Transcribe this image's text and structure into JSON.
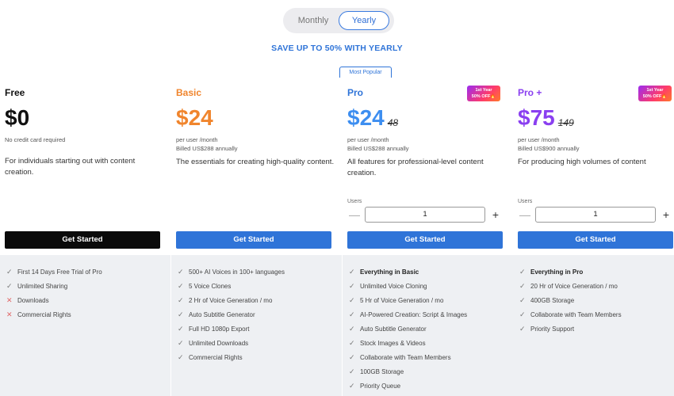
{
  "billing_toggle": {
    "monthly": "Monthly",
    "yearly": "Yearly"
  },
  "save_banner": "SAVE UP TO 50% WITH YEARLY",
  "most_popular": "Most Popular",
  "badge": {
    "line1": "1st Year",
    "line2": "50% OFF"
  },
  "users_label": "Users",
  "colors": {
    "blue": "#2f74d8",
    "orange": "#f0852d",
    "purple": "#8a3ff0",
    "black": "#0a0a0a"
  },
  "plans": [
    {
      "name": "Free",
      "price": "$0",
      "sub1": "No credit card required",
      "sub2": "",
      "desc": "For individuals starting out with content creation.",
      "button": "Get Started",
      "features": [
        {
          "icon": "check-icon",
          "text": "First 14 Days Free Trial of Pro"
        },
        {
          "icon": "check-icon",
          "text": "Unlimited Sharing"
        },
        {
          "icon": "x-icon",
          "text": "Downloads"
        },
        {
          "icon": "x-icon",
          "text": "Commercial Rights"
        }
      ]
    },
    {
      "name": "Basic",
      "price": "$24",
      "sub1": "per user /month",
      "sub2": "Billed US$288 annually",
      "desc": "The essentials for creating high-quality content.",
      "button": "Get Started",
      "features": [
        {
          "icon": "check-icon",
          "text": "500+ AI Voices in 100+ languages"
        },
        {
          "icon": "check-icon",
          "text": "5 Voice Clones"
        },
        {
          "icon": "check-icon",
          "text": "2 Hr of Voice Generation / mo"
        },
        {
          "icon": "check-icon",
          "text": "Auto Subtitle Generator"
        },
        {
          "icon": "check-icon",
          "text": "Full HD 1080p Export"
        },
        {
          "icon": "check-icon",
          "text": "Unlimited Downloads"
        },
        {
          "icon": "check-icon",
          "text": "Commercial Rights"
        }
      ]
    },
    {
      "name": "Pro",
      "price": "$24",
      "old_price": "48",
      "sub1": "per user /month",
      "sub2": "Billed US$288 annually",
      "desc": "All features for professional-level content creation.",
      "users_value": "1",
      "button": "Get Started",
      "features": [
        {
          "icon": "check-icon",
          "text": "Everything in Basic"
        },
        {
          "icon": "check-icon",
          "text": "Unlimited Voice Cloning"
        },
        {
          "icon": "check-icon",
          "text": "5 Hr of Voice Generation / mo"
        },
        {
          "icon": "check-icon",
          "text": "AI-Powered Creation: Script & Images"
        },
        {
          "icon": "check-icon",
          "text": "Auto Subtitle Generator"
        },
        {
          "icon": "check-icon",
          "text": "Stock Images & Videos"
        },
        {
          "icon": "check-icon",
          "text": "Collaborate with Team Members"
        },
        {
          "icon": "check-icon",
          "text": "100GB Storage"
        },
        {
          "icon": "check-icon",
          "text": "Priority Queue"
        }
      ]
    },
    {
      "name": "Pro +",
      "price": "$75",
      "old_price": "149",
      "sub1": "per user /month",
      "sub2": "Billed US$900 annually",
      "desc": "For producing high volumes of content",
      "users_value": "1",
      "button": "Get Started",
      "features": [
        {
          "icon": "check-icon",
          "text": "Everything in Pro"
        },
        {
          "icon": "check-icon",
          "text": "20 Hr of Voice Generation / mo"
        },
        {
          "icon": "check-icon",
          "text": "400GB Storage"
        },
        {
          "icon": "check-icon",
          "text": "Collaborate with Team Members"
        },
        {
          "icon": "check-icon",
          "text": "Priority Support"
        }
      ]
    }
  ]
}
